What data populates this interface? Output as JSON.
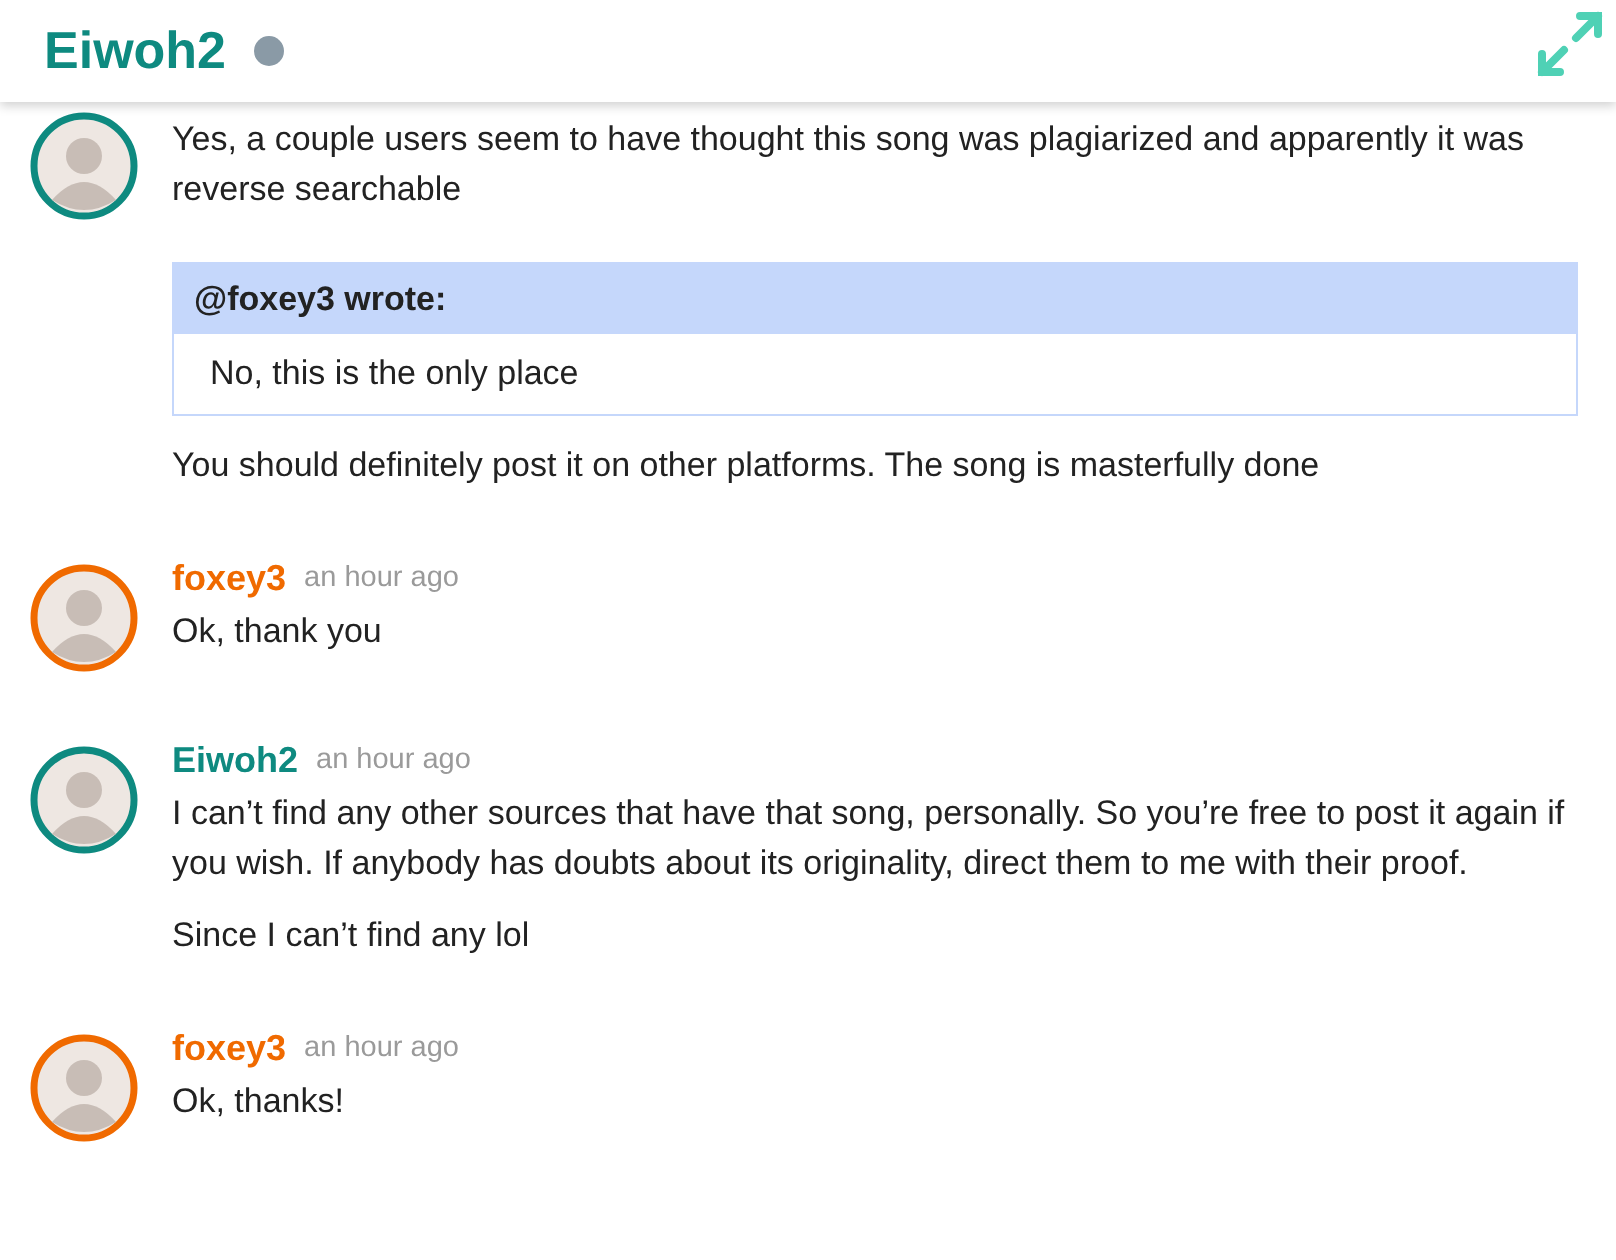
{
  "header": {
    "title": "Eiwoh2",
    "online": false
  },
  "messages": [
    {
      "color": "#0e8a80",
      "paragraphs": [
        {
          "kind": "text",
          "text": "Yes, a couple users seem to have thought this song was plagiarized and apparently it was reverse searchable"
        },
        {
          "kind": "quote",
          "header": "@foxey3 wrote:",
          "text": "No, this is the only place"
        },
        {
          "kind": "text",
          "text": "You should definitely post it on other platforms. The song is masterfully done"
        }
      ]
    },
    {
      "author": "foxey3",
      "color": "#f06a00",
      "time": "an hour ago",
      "paragraphs": [
        {
          "kind": "text",
          "text": "Ok, thank you"
        }
      ]
    },
    {
      "author": "Eiwoh2",
      "color": "#0e8a80",
      "time": "an hour ago",
      "paragraphs": [
        {
          "kind": "text",
          "text": "I can’t find any other sources that have that song, personally. So you’re free to post it again if you wish. If anybody has doubts about its originality, direct them to me with their proof."
        },
        {
          "kind": "text",
          "text": "Since I can’t find any lol"
        }
      ]
    },
    {
      "author": "foxey3",
      "color": "#f06a00",
      "time": "an hour ago",
      "paragraphs": [
        {
          "kind": "text",
          "text": "Ok, thanks!"
        }
      ]
    }
  ]
}
